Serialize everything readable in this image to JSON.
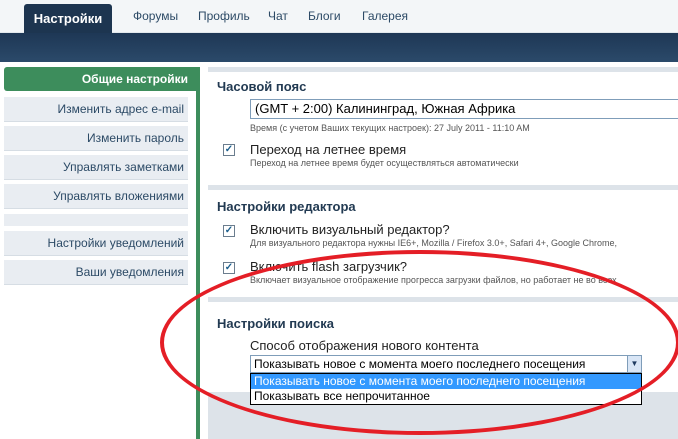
{
  "topnav": {
    "active_tab": "Настройки",
    "items": [
      "Форумы",
      "Профиль",
      "Чат",
      "Блоги",
      "Галерея"
    ]
  },
  "sidebar": {
    "active": "Общие настройки",
    "items": [
      "Изменить адрес e-mail",
      "Изменить пароль",
      "Управлять заметками",
      "Управлять вложениями",
      "Настройки уведомлений",
      "Ваши уведомления"
    ]
  },
  "timezone": {
    "heading": "Часовой пояс",
    "selected": "(GMT + 2:00) Калининград, Южная Африка",
    "time_hint": "Время (с учетом Ваших текущих настроек): 27 July 2011 - 11:10 AM",
    "dst_label": "Переход на летнее время",
    "dst_hint": "Переход на летнее время будет осуществляться автоматически"
  },
  "editor": {
    "heading": "Настройки редактора",
    "visual_label": "Включить визуальный редактор?",
    "visual_hint": "Для визуального редактора нужны IE6+, Mozilla / Firefox 3.0+, Safari 4+, Google Chrome,",
    "flash_label": "Включить flash загрузчик?",
    "flash_hint": "Включает визуальное отображение прогресса загрузки файлов, но работает не во всех"
  },
  "search": {
    "heading": "Настройки поиска",
    "label": "Способ отображения нового контента",
    "selected": "Показывать новое с момента моего последнего посещения",
    "options": [
      "Показывать новое с момента моего последнего посещения",
      "Показывать все непрочитанное"
    ]
  },
  "checkmark": "✓",
  "dropdown_arrow": "▼",
  "colors": {
    "nav_dark": "#1d3550",
    "sidebar_green": "#3d8d5c",
    "annotation_red": "#e41e26",
    "option_highlight": "#3399ff"
  }
}
